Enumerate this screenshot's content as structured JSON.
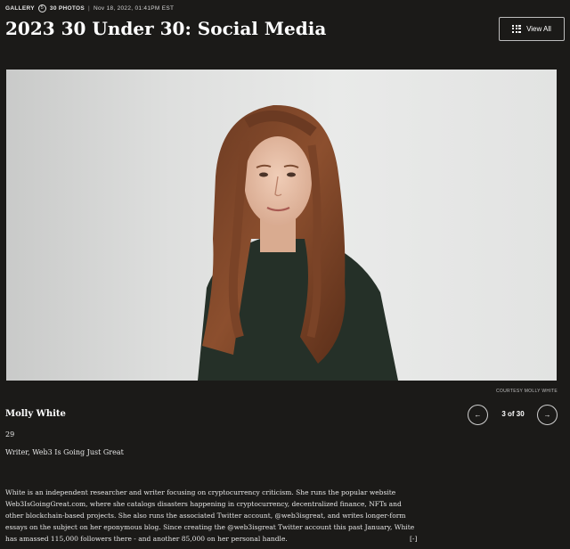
{
  "meta": {
    "gallery_label": "GALLERY",
    "photo_count_icon": "5",
    "photos_label": "30 PHOTOS",
    "separator": "|",
    "date": "Nov 18, 2022, 01:41PM EST"
  },
  "title": "2023 30 Under 30: Social Media",
  "view_all": {
    "label": "View All",
    "icon": "grid-icon"
  },
  "photo": {
    "credit": "COURTESY MOLLY WHITE"
  },
  "profile": {
    "name": "Molly White",
    "age": "29",
    "role": "Writer, Web3 Is Going Just Great"
  },
  "pager": {
    "prev_icon": "←",
    "counter": "3 of 30",
    "next_icon": "→"
  },
  "description": {
    "lines": [
      "White is an independent researcher and writer focusing on cryptocurrency criticism. She runs the popular website",
      "Web3IsGoingGreat.com, where she catalogs disasters happening in cryptocurrency, decentralized finance, NFTs and",
      "other blockchain-based projects. She also runs the associated Twitter account, @web3isgreat, and writes longer-form",
      "essays on the subject on her eponymous blog. Since creating the @web3isgreat Twitter account this past January, White",
      "has amassed 115,000 followers there - and another 85,000 on her personal handle."
    ],
    "collapse_label": "[-]"
  },
  "colors": {
    "background": "#1b1a18",
    "text": "#ffffff",
    "border": "#bdbdbd"
  }
}
